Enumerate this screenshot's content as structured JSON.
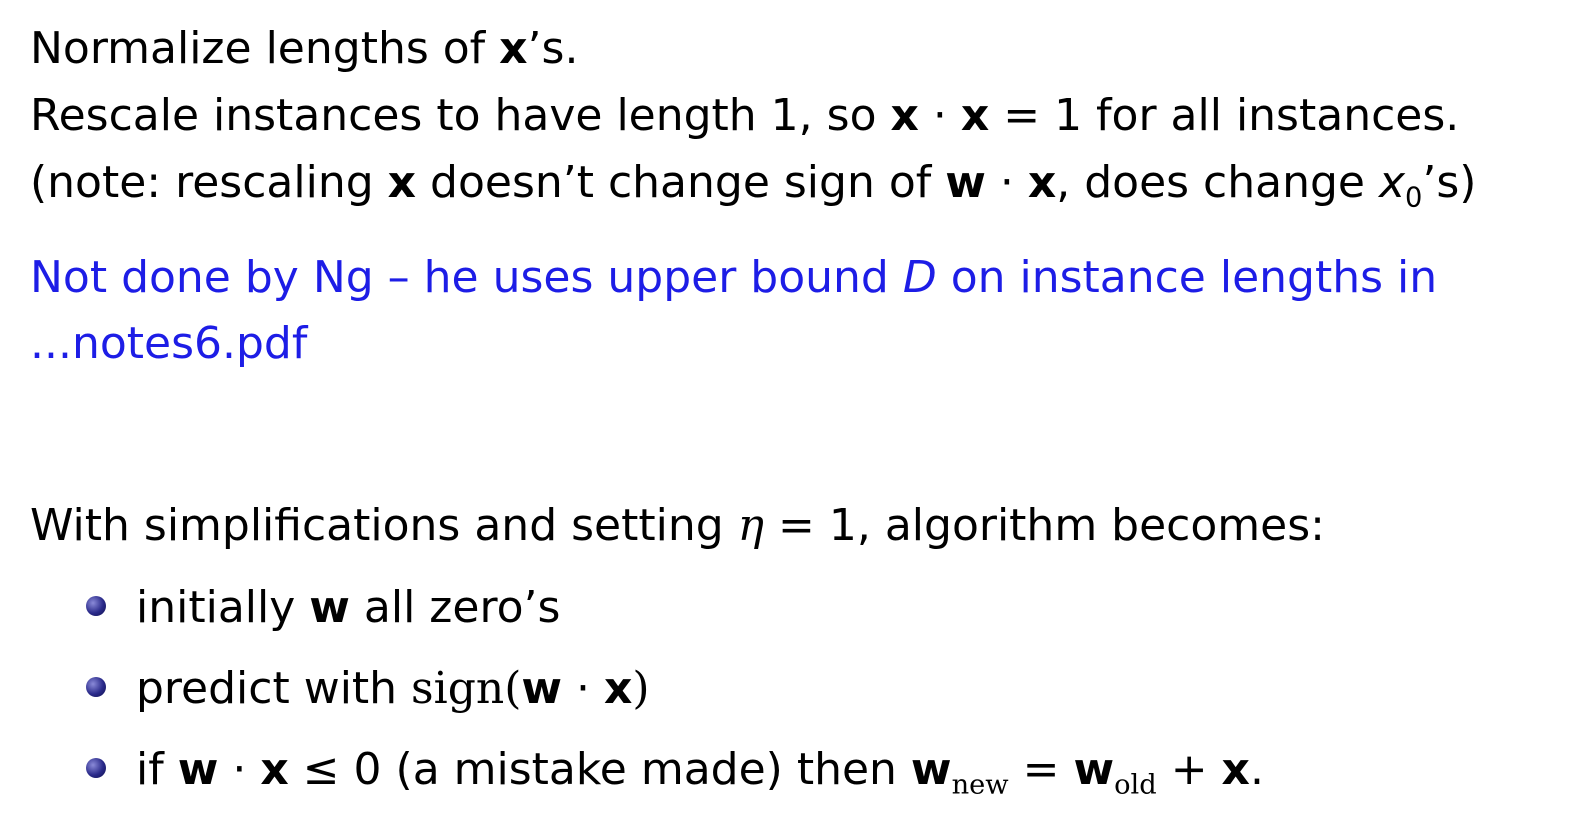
{
  "slide": {
    "line1": {
      "pre": "Normalize lengths of ",
      "x": "x",
      "post": "’s."
    },
    "line2": {
      "pre": "Rescale instances to have length 1, so ",
      "x1": "x",
      "dot": " · ",
      "x2": "x",
      "post": " = 1 for all instances."
    },
    "line3": {
      "pre": "(note:  rescaling ",
      "x": "x",
      "mid": " doesn’t change sign of ",
      "w": "w",
      "dot": " · ",
      "x2": "x",
      "mid2": ", does change ",
      "xvar": "x",
      "sub": "0",
      "post": "’s)"
    },
    "blue1": {
      "pre": "Not done by Ng – he uses upper bound ",
      "D": "D",
      "post": " on instance lengths in"
    },
    "blue2": "...notes6.pdf",
    "line4": {
      "pre": "With simplifications and setting ",
      "eta": "η",
      "post": " = 1, algorithm becomes:"
    },
    "bullets": [
      {
        "pre": "initially ",
        "w": "w",
        "post": " all zero’s"
      },
      {
        "pre": "predict with ",
        "sign": "sign",
        "open": "(",
        "w": "w",
        "dot": " · ",
        "x": "x",
        "close": ")"
      },
      {
        "pre": "if ",
        "w": "w",
        "dot": " · ",
        "x": "x",
        "mid": " ≤ 0 (a mistake made) then ",
        "w2": "w",
        "sub_new": "new",
        "eq": " = ",
        "w3": "w",
        "sub_old": "old",
        "plus": " + ",
        "x2": "x",
        "end": "."
      }
    ]
  }
}
